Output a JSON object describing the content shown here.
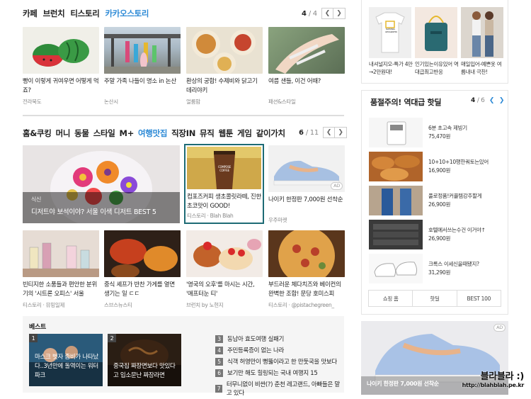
{
  "section1": {
    "tabs": [
      "카페",
      "브런치",
      "티스토리",
      "카카오스토리"
    ],
    "active_tab": "카카오스토리",
    "page_current": "4",
    "page_total": "/ 4",
    "cards": [
      {
        "title": "빵이 이렇게 귀여우면 어떻게 먹죠?",
        "source": "전라북도"
      },
      {
        "title": "주말 가족 나들이 명소 in 논산",
        "source": "논산시"
      },
      {
        "title": "환상의 궁합! 수제비와 닭고기데리야키",
        "source": "얼룸맘"
      },
      {
        "title": "여름 샌들, 이건 어때?",
        "source": "패션&스타일"
      }
    ]
  },
  "section2": {
    "tabs": [
      "홈&쿠킹",
      "머니",
      "동물",
      "스타일",
      "M+",
      "여행맛집",
      "직장IN",
      "뮤직",
      "웹툰",
      "게임",
      "같이가치"
    ],
    "active_tab": "여행맛집",
    "page_current": "6",
    "page_total": "/ 11",
    "feature": {
      "category": "식신",
      "title": "디저트야 보석이야? 서울 이색 디저트 BEST 5"
    },
    "row1": [
      {
        "title": "컴포즈커피 생초콜릿라떼, 진한 초코맛이 GOOD!",
        "source": "티스토리 · Blah Blah",
        "cup_text": "COMPOSE COFFEE"
      },
      {
        "title": "나이키 한정판 7,000원 선착순",
        "source": "우주마켓",
        "ad": "AD"
      }
    ],
    "row2": [
      {
        "title": "빈티지한 소품들과 편안한 분위기의 '시트론 오피스' 서울",
        "source": "티스토리 · 뮤밍일제"
      },
      {
        "title": "중식 셰프가 반찬 가게를 열면 생기는 일 ㄷㄷ",
        "source": "스브스뉴스티"
      },
      {
        "title": "'영국의 오후'를 마시는 시간, '애프터눈 티'",
        "source": "브런치 by 노현지"
      },
      {
        "title": "부드러운 체다치즈와 베이컨의 완벽한 조합! 문당 호미스피",
        "source": "티스토리 · @pistachegreen_"
      }
    ]
  },
  "best": {
    "header": "베스트",
    "thumbs": [
      {
        "num": "1",
        "title": "마스크 벗자 좀비가 나타났다..3년만에 돌역이는 워터파크"
      },
      {
        "num": "2",
        "title": "중국집 짜장면보다 맛있다고 입소문난 짜장라면"
      }
    ],
    "list": [
      {
        "num": "3",
        "title": "동남아 효도여행 실패기"
      },
      {
        "num": "4",
        "title": "주민등록증이 없는 나라"
      },
      {
        "num": "5",
        "title": "식객 허영만이 뻥뚫이라고 한 만둣국을 맛보다"
      },
      {
        "num": "6",
        "title": "보기만 해도 힐링되는 국내 여행지 15"
      },
      {
        "num": "7",
        "title": "터무니없이 비싼(?) 춘천 레고랜드, 아빠들은 말고 있다"
      }
    ]
  },
  "right_top": {
    "items": [
      {
        "title": "내셔널지오-특가 4만→2만원대!",
        "logo": "NATIONAL GEOGRAPHIC"
      },
      {
        "title": "인기있는이유있어 역대급최고반응"
      },
      {
        "title": "매일입어-예쁜옷 여름내내 극찬!"
      }
    ]
  },
  "deals": {
    "title": "품절주의! 역대급 핫딜",
    "page_current": "4",
    "page_total": "/ 6",
    "products": [
      {
        "name": "6분 초고속 제빙기",
        "price": "75,470원"
      },
      {
        "name": "10+10+10행한쿼토는있어",
        "price": "16,900원"
      },
      {
        "name": "풀로정품!커플템강추할게",
        "price": "26,900원"
      },
      {
        "name": "호텔에서쓰는수건 이거야↑",
        "price": "26,900원"
      },
      {
        "name": "크록스 이세신을때됐지?",
        "price": "31,290원"
      }
    ],
    "tabs": [
      "쇼핑 홈",
      "핫딜",
      "BEST 100"
    ]
  },
  "ad_banner": {
    "ad": "AD",
    "text": "나이키 한정판 7,000원 선착순"
  },
  "watermark": {
    "line1": "블라블라 :)",
    "line2": "http://blahblah.pe.kr"
  },
  "colors": {
    "accent": "#2d8ad6",
    "highlight_border": "#1e6b75"
  }
}
